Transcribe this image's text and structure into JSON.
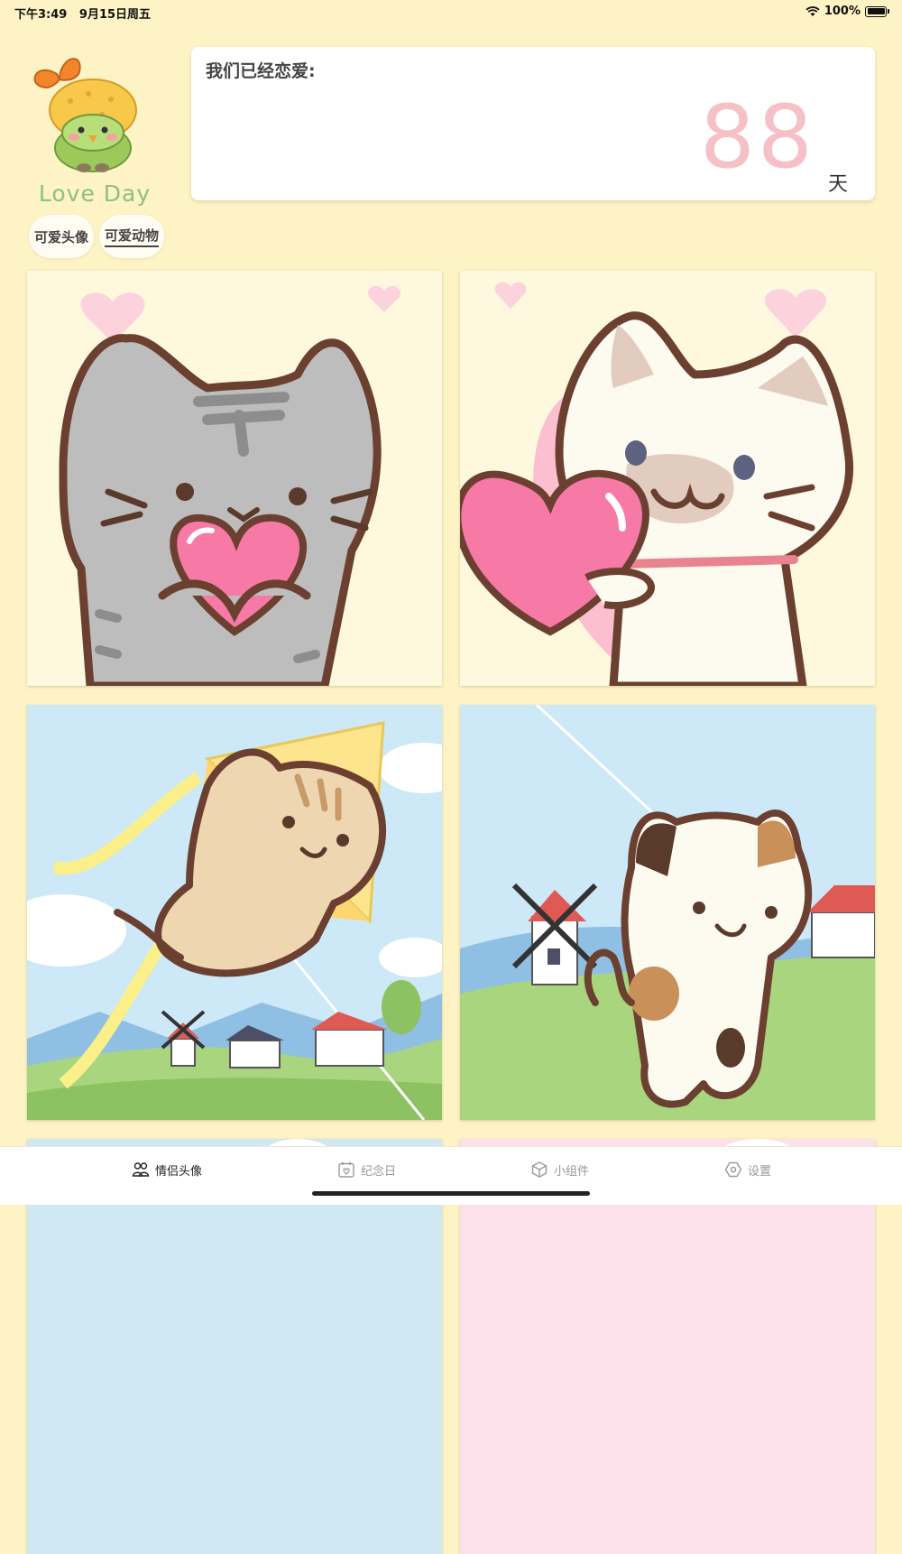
{
  "status_bar": {
    "time": "下午3:49",
    "date": "9月15日周五",
    "battery": "100%"
  },
  "logo": {
    "text": "Love Day"
  },
  "tags": [
    {
      "label": "可爱头像"
    },
    {
      "label": "可爱动物"
    }
  ],
  "counter": {
    "label": "我们已经恋爱:",
    "value": "88",
    "unit": "天"
  },
  "gallery": [
    {
      "name": "gray-tabby-cat-heart"
    },
    {
      "name": "cream-cat-heart"
    },
    {
      "name": "tabby-cat-kite"
    },
    {
      "name": "calico-cat-windmill"
    }
  ],
  "tab_bar": {
    "items": [
      {
        "label": "情侣头像",
        "icon": "couple-avatar-icon",
        "active": true
      },
      {
        "label": "纪念日",
        "icon": "calendar-heart-icon",
        "active": false
      },
      {
        "label": "小组件",
        "icon": "widget-cube-icon",
        "active": false
      },
      {
        "label": "设置",
        "icon": "settings-hexagon-icon",
        "active": false
      }
    ]
  },
  "colors": {
    "background": "#fdf3c4",
    "counter_pink": "#f5c0c6",
    "logo_green": "#8fc07e",
    "brown_outline": "#6b4030"
  }
}
